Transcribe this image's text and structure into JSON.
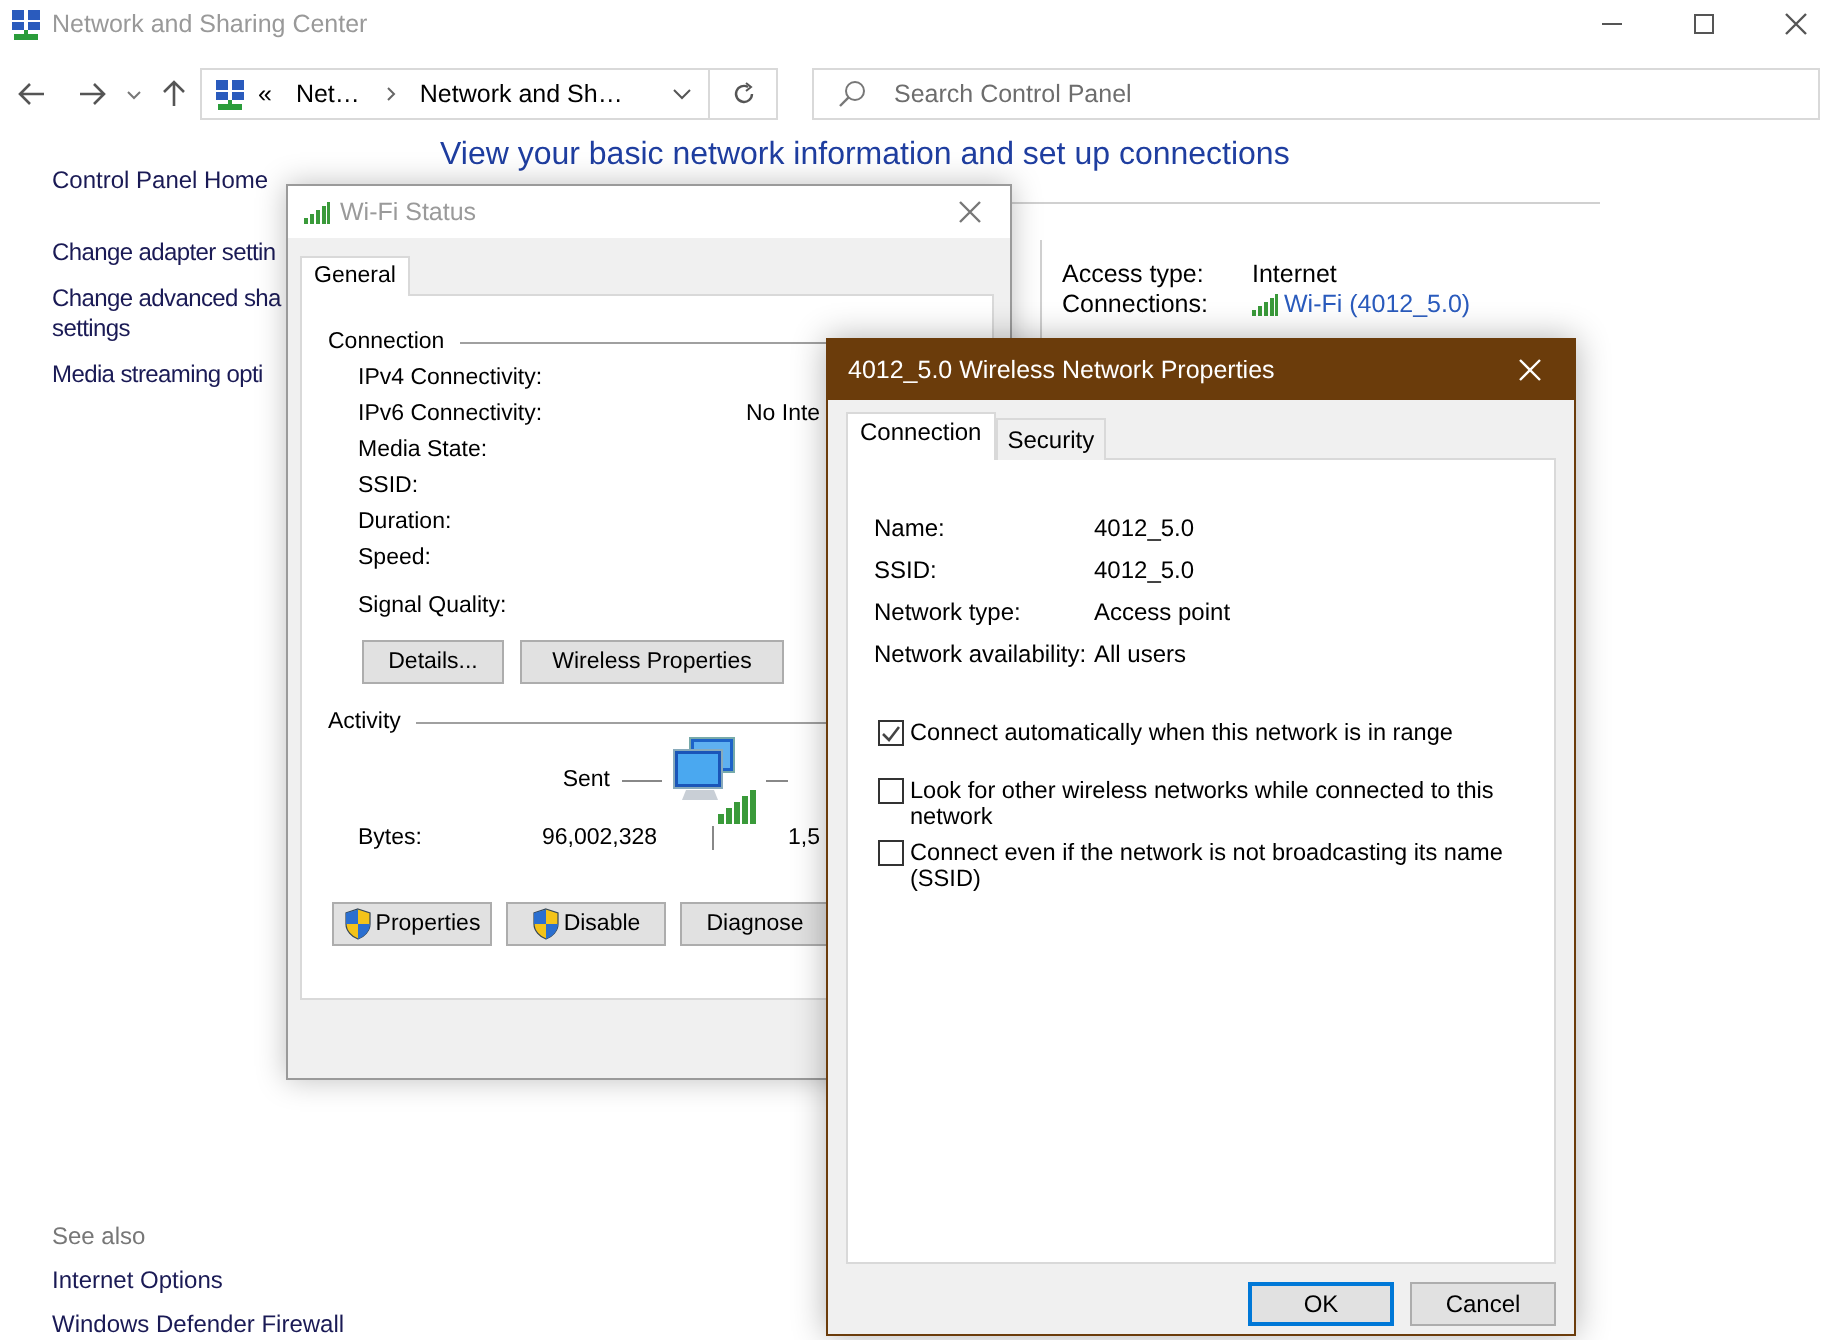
{
  "window": {
    "title": "Network and Sharing Center"
  },
  "address_bar": {
    "overflow": "«",
    "breadcrumbs": [
      "Net…",
      "Network and Sh…"
    ]
  },
  "search": {
    "placeholder": "Search Control Panel"
  },
  "sidebar": {
    "items": [
      {
        "lines": [
          "Control Panel Home"
        ]
      },
      {
        "lines": [
          "Change adapter settin"
        ]
      },
      {
        "lines": [
          "Change advanced sha",
          "settings"
        ]
      },
      {
        "lines": [
          "Media streaming opti"
        ]
      }
    ]
  },
  "see_also": {
    "title": "See also",
    "items": [
      "Internet Options",
      "Windows Defender Firewall"
    ]
  },
  "heading": "View your basic network information and set up connections",
  "network_info": [
    {
      "label": "Access type:",
      "value": "Internet",
      "kind": "text"
    },
    {
      "label": "Connections:",
      "value": "Wi-Fi (4012_5.0)",
      "kind": "link"
    }
  ],
  "wifi_status": {
    "title": "Wi-Fi Status",
    "tabs": [
      {
        "label": "General",
        "selected": true
      }
    ],
    "connection": {
      "title": "Connection",
      "rows": [
        {
          "label": "IPv4 Connectivity:"
        },
        {
          "label": "IPv6 Connectivity:",
          "value": "No Inte"
        },
        {
          "label": "Media State:"
        },
        {
          "label": "SSID:"
        },
        {
          "label": "Duration:"
        },
        {
          "label": "Speed:"
        },
        {
          "label": "Signal Quality:"
        }
      ]
    },
    "buttons": [
      "Details...",
      "Wireless Properties"
    ],
    "activity": {
      "title": "Activity",
      "sent_label": "Sent",
      "bytes_label": "Bytes:",
      "sent_bytes": "96,002,328",
      "received_bytes": "1,5"
    },
    "bottom_buttons": [
      {
        "label": "Properties",
        "kind": "admin"
      },
      {
        "label": "Disable",
        "kind": "admin"
      },
      {
        "label": "Diagnose",
        "kind": "plain"
      }
    ]
  },
  "network_properties": {
    "title": "4012_5.0 Wireless Network Properties",
    "tabs": [
      {
        "label": "Connection",
        "selected": true
      },
      {
        "label": "Security",
        "selected": false
      }
    ],
    "fields": [
      {
        "label": "Name:",
        "value": "4012_5.0"
      },
      {
        "label": "SSID:",
        "value": "4012_5.0"
      },
      {
        "label": "Network type:",
        "value": "Access point"
      },
      {
        "label": "Network availability:",
        "value": "All users"
      }
    ],
    "options": [
      {
        "label": "Connect automatically when this network is in range",
        "checked": true
      },
      {
        "label": "Look for other wireless networks while connected to this network",
        "checked": false
      },
      {
        "label": "Connect even if the network is not broadcasting its name (SSID)",
        "checked": false
      }
    ],
    "buttons": [
      {
        "label": "OK",
        "default": true
      },
      {
        "label": "Cancel",
        "default": false
      }
    ]
  }
}
